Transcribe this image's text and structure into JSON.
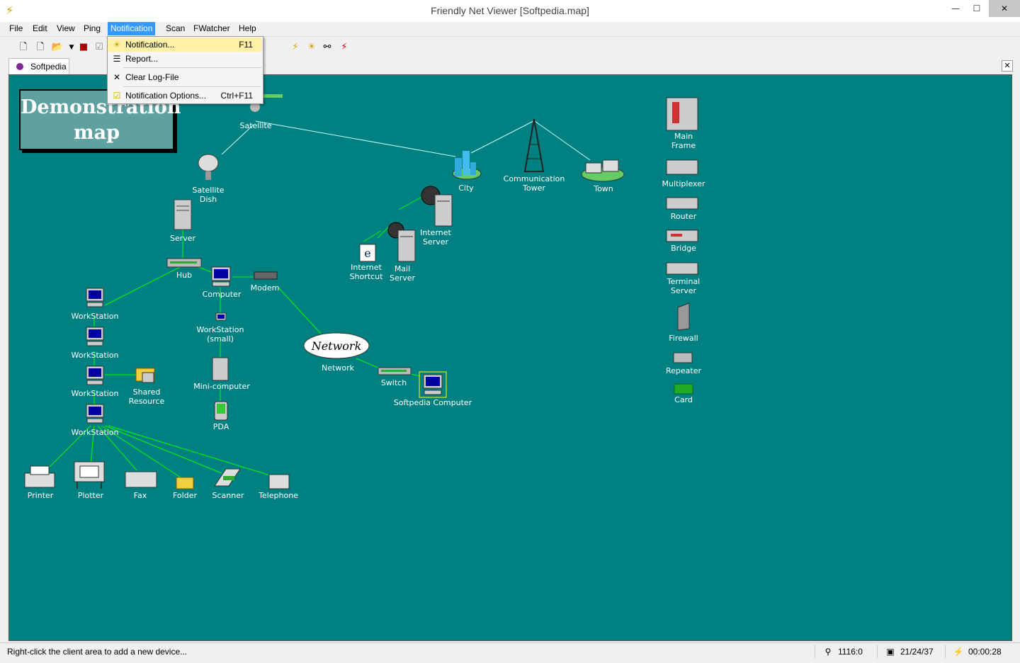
{
  "window": {
    "title": "Friendly Net Viewer [Softpedia.map]",
    "minimize": "—",
    "maximize": "☐",
    "close": "✕"
  },
  "menu": [
    {
      "label": "File"
    },
    {
      "label": "Edit"
    },
    {
      "label": "View"
    },
    {
      "label": "Ping"
    },
    {
      "label": "Notification",
      "active": true
    },
    {
      "label": "Scan"
    },
    {
      "label": "FWatcher"
    },
    {
      "label": "Help"
    }
  ],
  "notification_menu": {
    "items": [
      {
        "label": "Notification...",
        "shortcut": "F11",
        "icon": "bell-icon"
      },
      {
        "label": "Report...",
        "shortcut": "",
        "icon": "report-icon"
      },
      {
        "label": "Clear Log-File",
        "shortcut": "",
        "icon": "clear-icon"
      },
      {
        "label": "Notification Options...",
        "shortcut": "Ctrl+F11",
        "icon": "options-icon"
      }
    ]
  },
  "tab": {
    "label": "Softpedia",
    "close": "✕"
  },
  "map": {
    "background": "#008080",
    "title": "Demonstration\nmap",
    "devices": [
      {
        "label": "Satellite",
        "icon": "satellite-icon"
      },
      {
        "label": "Satellite\nDish",
        "icon": "satellite-dish-icon"
      },
      {
        "label": "Server",
        "icon": "server-icon"
      },
      {
        "label": "Hub",
        "icon": "hub-icon"
      },
      {
        "label": "Computer",
        "icon": "computer-icon"
      },
      {
        "label": "Modem",
        "icon": "modem-icon"
      },
      {
        "label": "WorkStation",
        "icon": "workstation-icon"
      },
      {
        "label": "WorkStation",
        "icon": "workstation-icon"
      },
      {
        "label": "WorkStation",
        "icon": "workstation-icon"
      },
      {
        "label": "WorkStation",
        "icon": "workstation-icon"
      },
      {
        "label": "Shared\nResource",
        "icon": "shared-folder-icon"
      },
      {
        "label": "WorkStation\n(small)",
        "icon": "workstation-icon"
      },
      {
        "label": "Mini-computer",
        "icon": "minicomputer-icon"
      },
      {
        "label": "PDA",
        "icon": "pda-icon"
      },
      {
        "label": "Network",
        "icon": "cloud-icon"
      },
      {
        "label": "Switch",
        "icon": "switch-icon"
      },
      {
        "label": "Softpedia Computer",
        "icon": "computer-icon"
      },
      {
        "label": "City",
        "icon": "city-icon"
      },
      {
        "label": "Communication\nTower",
        "icon": "tower-icon"
      },
      {
        "label": "Town",
        "icon": "town-icon"
      },
      {
        "label": "Internet\nServer",
        "icon": "server-icon"
      },
      {
        "label": "Internet\nShortcut",
        "icon": "ie-icon"
      },
      {
        "label": "Mail\nServer",
        "icon": "server-icon"
      },
      {
        "label": "Printer",
        "icon": "printer-icon"
      },
      {
        "label": "Plotter",
        "icon": "plotter-icon"
      },
      {
        "label": "Fax",
        "icon": "fax-icon"
      },
      {
        "label": "Folder",
        "icon": "folder-icon"
      },
      {
        "label": "Scanner",
        "icon": "scanner-icon"
      },
      {
        "label": "Telephone",
        "icon": "telephone-icon"
      },
      {
        "label": "Main\nFrame",
        "icon": "mainframe-icon"
      },
      {
        "label": "Multiplexer",
        "icon": "multiplexer-icon"
      },
      {
        "label": "Router",
        "icon": "router-icon"
      },
      {
        "label": "Bridge",
        "icon": "bridge-icon"
      },
      {
        "label": "Terminal\nServer",
        "icon": "terminal-server-icon"
      },
      {
        "label": "Firewall",
        "icon": "firewall-icon"
      },
      {
        "label": "Repeater",
        "icon": "repeater-icon"
      },
      {
        "label": "Card",
        "icon": "card-icon"
      }
    ],
    "network_cloud_text": "Network"
  },
  "status": {
    "hint": "Right-click the client area to add a new device...",
    "counter": "1116:0",
    "devices": "21/24/37",
    "time": "00:00:28"
  }
}
